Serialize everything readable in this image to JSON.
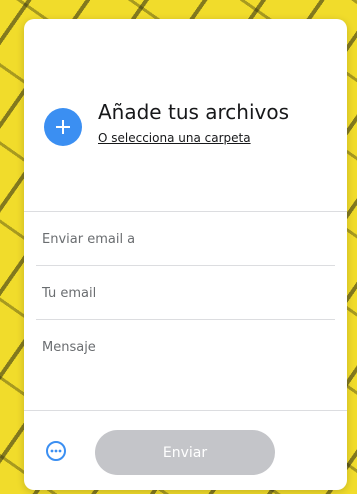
{
  "upload": {
    "title": "Añade tus archivos",
    "folder_link": "O selecciona una carpeta",
    "add_icon": "plus-icon"
  },
  "form": {
    "to_placeholder": "Enviar email a",
    "from_placeholder": "Tu email",
    "message_placeholder": "Mensaje"
  },
  "footer": {
    "more_icon": "ellipsis-icon",
    "send_label": "Enviar"
  },
  "colors": {
    "accent": "#3b8ff2",
    "send_disabled": "#c4c5c9",
    "background": "#f1dc2b"
  }
}
